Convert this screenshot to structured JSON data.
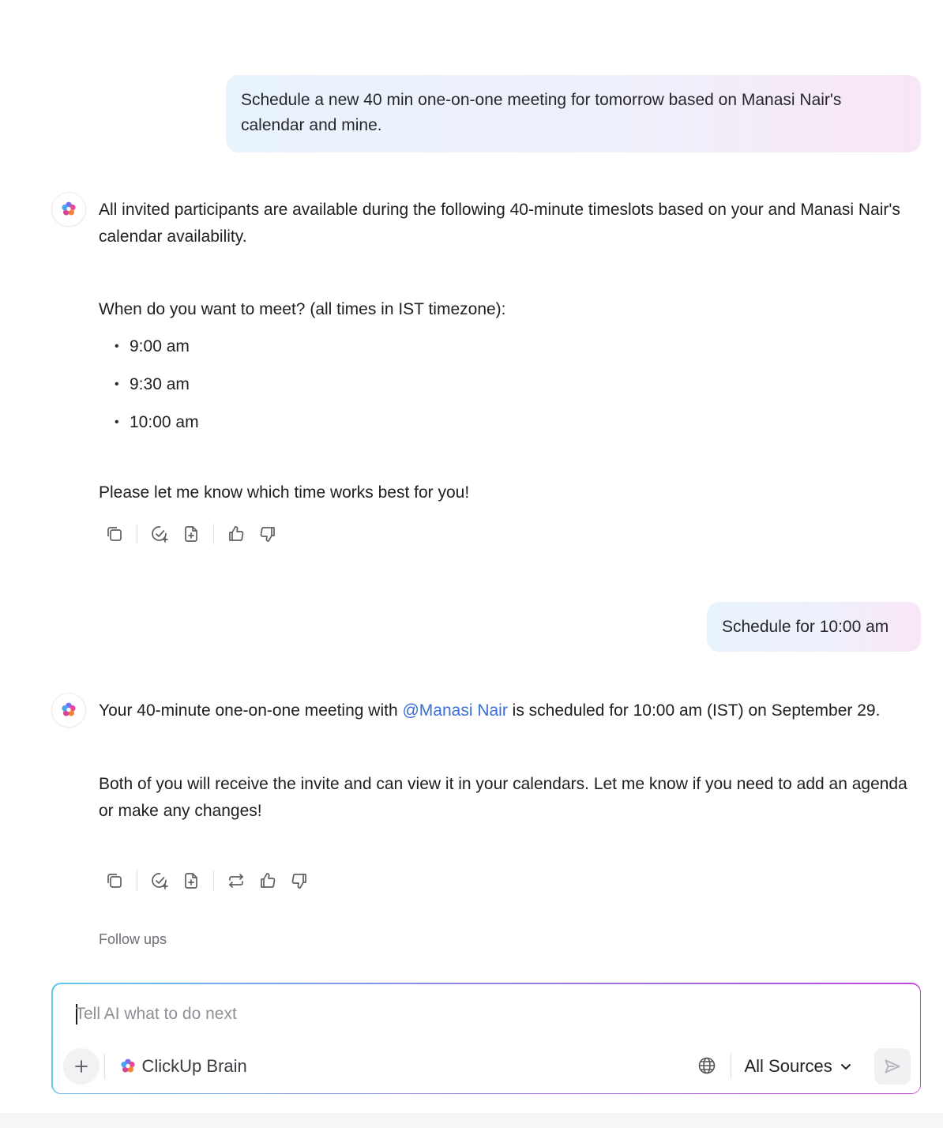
{
  "conversation": {
    "user_message_1": "Schedule a new 40 min one-on-one meeting for tomorrow based on Manasi Nair's calendar and mine.",
    "ai_response_1": {
      "paragraph_1": "All invited participants are available during the following 40-minute timeslots based on your and Manasi Nair's calendar availability.",
      "question": "When do you want to meet? (all times in IST timezone):",
      "timeslots": [
        "9:00 am",
        "9:30 am",
        "10:00 am"
      ],
      "closing": "Please let me know which time works best for you!"
    },
    "user_message_2": "Schedule for 10:00 am",
    "ai_response_2": {
      "text_before_mention": "Your 40-minute one-on-one meeting with ",
      "mention": "@Manasi Nair",
      "text_after_mention": " is scheduled for 10:00 am (IST) on September 29.",
      "paragraph_2": "Both of you will receive the invite and can view it in your calendars. Let me know if you need to add an agenda or make any changes!"
    },
    "followups_label": "Follow ups"
  },
  "actions": {
    "icons_response_1": [
      "copy-icon",
      "create-task-icon",
      "create-doc-icon",
      "thumbs-up-icon",
      "thumbs-down-icon"
    ],
    "icons_response_2": [
      "copy-icon",
      "create-task-icon",
      "create-doc-icon",
      "regenerate-icon",
      "thumbs-up-icon",
      "thumbs-down-icon"
    ]
  },
  "composer": {
    "placeholder": "Tell AI what to do next",
    "model_label": "ClickUp Brain",
    "sources_label": "All Sources"
  },
  "colors": {
    "mention": "#3b6fd4",
    "bubble_gradient": [
      "#e8f3fd",
      "#f9e6f6"
    ],
    "composer_border_gradient": [
      "#62c8ee",
      "#c443d4"
    ]
  }
}
